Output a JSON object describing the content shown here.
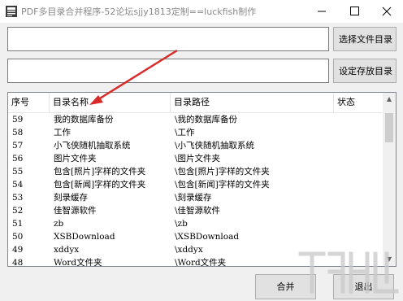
{
  "window": {
    "title": "PDF多目录合并程序-52论坛sjjy1813定制==luckfish制作"
  },
  "buttons": {
    "select_dir": "选择文件目录",
    "set_save_dir": "设定存放目录",
    "merge": "合并",
    "exit": "退出"
  },
  "inputs": {
    "source_dir": "",
    "save_dir": ""
  },
  "table": {
    "columns": [
      "序号",
      "目录名称",
      "目录路径",
      "状态"
    ],
    "rows": [
      {
        "no": "59",
        "name": "我的数据库备份",
        "path": "\\我的数据库备份"
      },
      {
        "no": "58",
        "name": "工作",
        "path": "\\工作"
      },
      {
        "no": "57",
        "name": "小飞侠随机抽取系统",
        "path": "\\小飞侠随机抽取系统"
      },
      {
        "no": "56",
        "name": "图片文件夹",
        "path": "\\图片文件夹"
      },
      {
        "no": "55",
        "name": "包含[照片]字样的文件夹",
        "path": "\\包含[照片]字样的文件夹"
      },
      {
        "no": "54",
        "name": "包含[新闻]字样的文件夹",
        "path": "\\包含[新闻]字样的文件夹"
      },
      {
        "no": "53",
        "name": "刻录缓存",
        "path": "\\刻录缓存"
      },
      {
        "no": "52",
        "name": "佳智源软件",
        "path": "\\佳智源软件"
      },
      {
        "no": "51",
        "name": "zb",
        "path": "\\zb"
      },
      {
        "no": "50",
        "name": "XSBDownload",
        "path": "\\XSBDownload"
      },
      {
        "no": "49",
        "name": "xddyx",
        "path": "\\xddyx"
      },
      {
        "no": "48",
        "name": "Word文件夹",
        "path": "\\Word文件夹"
      }
    ]
  },
  "icons": {
    "app": "pdf-app-icon",
    "minimize": "minimize-icon",
    "maximize": "maximize-icon",
    "close": "close-icon",
    "scroll_up": "scroll-up-icon",
    "scroll_down": "scroll-down-icon"
  },
  "colors": {
    "annotation_arrow": "#d92a2a",
    "window_bg": "#f0f0f0",
    "button_bg": "#e1e1e1"
  }
}
